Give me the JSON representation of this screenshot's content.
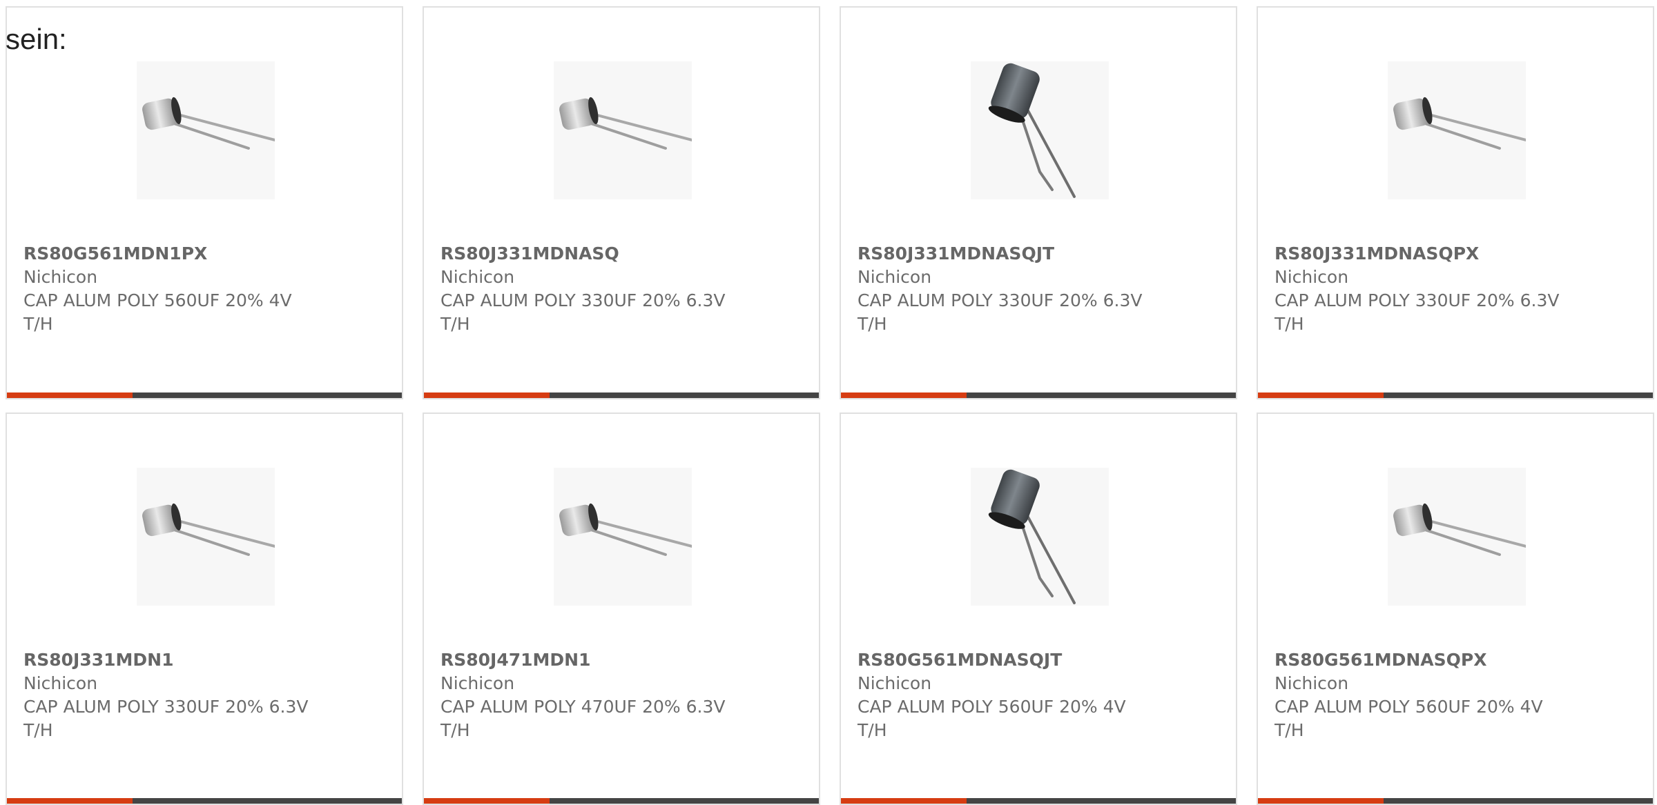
{
  "intro_text": "sein:",
  "accent_color": "#d63c12",
  "bar_color": "#444444",
  "products": [
    {
      "part": "RS80G561MDN1PX",
      "maker": "Nichicon",
      "desc": "CAP ALUM POLY 560UF 20% 4V",
      "mount": "T/H",
      "image_icon": "small-radial-capacitor-icon"
    },
    {
      "part": "RS80J331MDNASQ",
      "maker": "Nichicon",
      "desc": "CAP ALUM POLY 330UF 20% 6.3V",
      "mount": "T/H",
      "image_icon": "small-radial-capacitor-icon"
    },
    {
      "part": "RS80J331MDNASQJT",
      "maker": "Nichicon",
      "desc": "CAP ALUM POLY 330UF 20% 6.3V",
      "mount": "T/H",
      "image_icon": "dark-radial-capacitor-icon"
    },
    {
      "part": "RS80J331MDNASQPX",
      "maker": "Nichicon",
      "desc": "CAP ALUM POLY 330UF 20% 6.3V",
      "mount": "T/H",
      "image_icon": "small-radial-capacitor-icon"
    },
    {
      "part": "RS80J331MDN1",
      "maker": "Nichicon",
      "desc": "CAP ALUM POLY 330UF 20% 6.3V",
      "mount": "T/H",
      "image_icon": "small-radial-capacitor-icon"
    },
    {
      "part": "RS80J471MDN1",
      "maker": "Nichicon",
      "desc": "CAP ALUM POLY 470UF 20% 6.3V",
      "mount": "T/H",
      "image_icon": "small-radial-capacitor-icon"
    },
    {
      "part": "RS80G561MDNASQJT",
      "maker": "Nichicon",
      "desc": "CAP ALUM POLY 560UF 20% 4V",
      "mount": "T/H",
      "image_icon": "dark-radial-capacitor-icon"
    },
    {
      "part": "RS80G561MDNASQPX",
      "maker": "Nichicon",
      "desc": "CAP ALUM POLY 560UF 20% 4V",
      "mount": "T/H",
      "image_icon": "small-radial-capacitor-icon"
    }
  ]
}
